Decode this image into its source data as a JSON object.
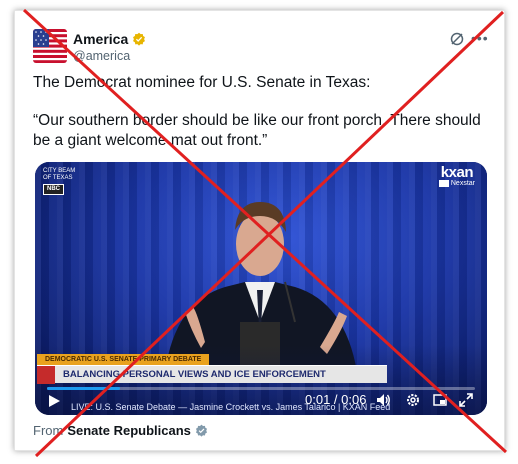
{
  "account": {
    "display_name": "America",
    "handle": "@america"
  },
  "tweet": {
    "line1": "The Democrat nominee for U.S. Senate in Texas:",
    "line2": "“Our southern border should be like our front porch. There should be a giant welcome mat out front.”"
  },
  "video": {
    "logo_left_small": "CITY BEAM OF TEXAS",
    "logo_left_box": "NBC",
    "station": "kxan",
    "network": "Nexstar",
    "lower_third_top": "DEMOCRATIC U.S. SENATE PRIMARY DEBATE",
    "lower_third_main": "BALANCING PERSONAL VIEWS AND ICE ENFORCEMENT",
    "caption_ticker": "LIVE: U.S. Senate Debate — Jasmine Crockett vs. James Talarico | KXAN Feed",
    "time_display": "0:01 / 0:06",
    "progress_fraction": 0.17
  },
  "footer": {
    "from_label": "From",
    "source_name": "Senate Republicans"
  },
  "colors": {
    "verified_gold": "#e8b500",
    "accent_blue": "#1d9bf0",
    "cross_red": "#e02020"
  },
  "icons": [
    "flag-avatar",
    "verified-badge-icon",
    "grok-icon",
    "more-icon",
    "play-icon",
    "volume-icon",
    "settings-icon",
    "pip-icon",
    "fullscreen-icon",
    "gray-verified-icon"
  ]
}
